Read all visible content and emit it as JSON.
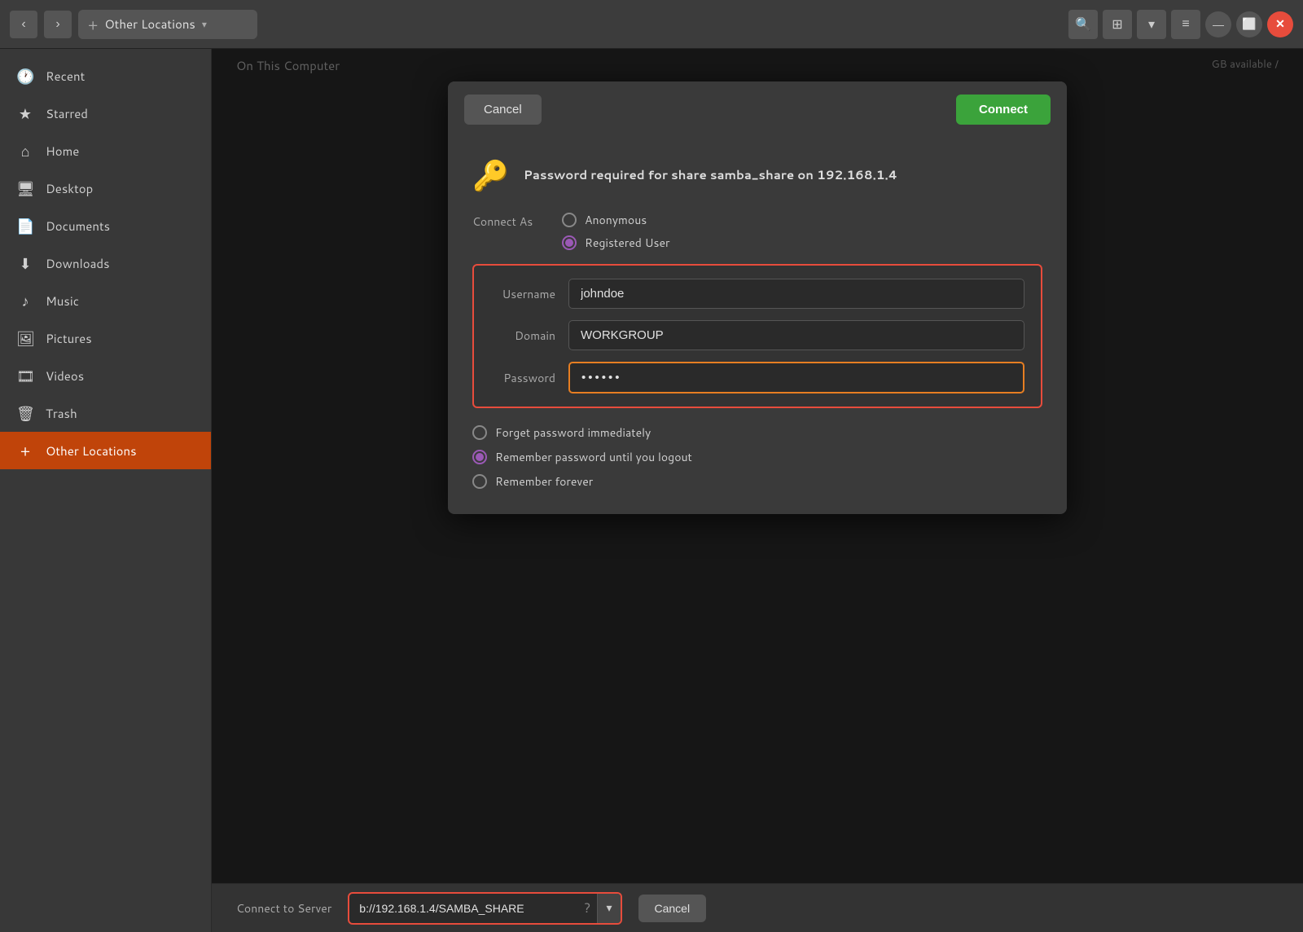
{
  "titlebar": {
    "back_label": "‹",
    "forward_label": "›",
    "plus_label": "+",
    "location_label": "Other Locations",
    "dropdown_label": "▾",
    "search_label": "🔍",
    "list_label": "⊞",
    "list_dropdown": "▾",
    "menu_label": "≡",
    "minimize_label": "—",
    "maximize_label": "⬜",
    "close_label": "✕"
  },
  "sidebar": {
    "items": [
      {
        "id": "recent",
        "icon": "🕐",
        "label": "Recent"
      },
      {
        "id": "starred",
        "icon": "★",
        "label": "Starred"
      },
      {
        "id": "home",
        "icon": "⌂",
        "label": "Home"
      },
      {
        "id": "desktop",
        "icon": "🖥",
        "label": "Desktop"
      },
      {
        "id": "documents",
        "icon": "📄",
        "label": "Documents"
      },
      {
        "id": "downloads",
        "icon": "⬇",
        "label": "Downloads"
      },
      {
        "id": "music",
        "icon": "♪",
        "label": "Music"
      },
      {
        "id": "pictures",
        "icon": "🖼",
        "label": "Pictures"
      },
      {
        "id": "videos",
        "icon": "🎞",
        "label": "Videos"
      },
      {
        "id": "trash",
        "icon": "🗑",
        "label": "Trash"
      },
      {
        "id": "other-locations",
        "icon": "+",
        "label": "Other Locations",
        "active": true
      }
    ]
  },
  "content": {
    "header": "On This Computer",
    "available_text": "GB available",
    "slash": "/"
  },
  "dialog": {
    "cancel_label": "Cancel",
    "connect_label": "Connect",
    "title": "Password required for share samba_share on 192.168.1.4",
    "connect_as_label": "Connect As",
    "anonymous_label": "Anonymous",
    "registered_label": "Registered User",
    "username_label": "Username",
    "username_value": "johndoe",
    "domain_label": "Domain",
    "domain_value": "WORKGROUP",
    "password_label": "Password",
    "password_value": "••••••",
    "forget_label": "Forget password immediately",
    "remember_logout_label": "Remember password until you logout",
    "remember_forever_label": "Remember forever"
  },
  "bottom_bar": {
    "label": "Connect to Server",
    "server_value": "b://192.168.1.4/SAMBA_SHARE",
    "help_icon": "?",
    "cancel_label": "Cancel"
  }
}
